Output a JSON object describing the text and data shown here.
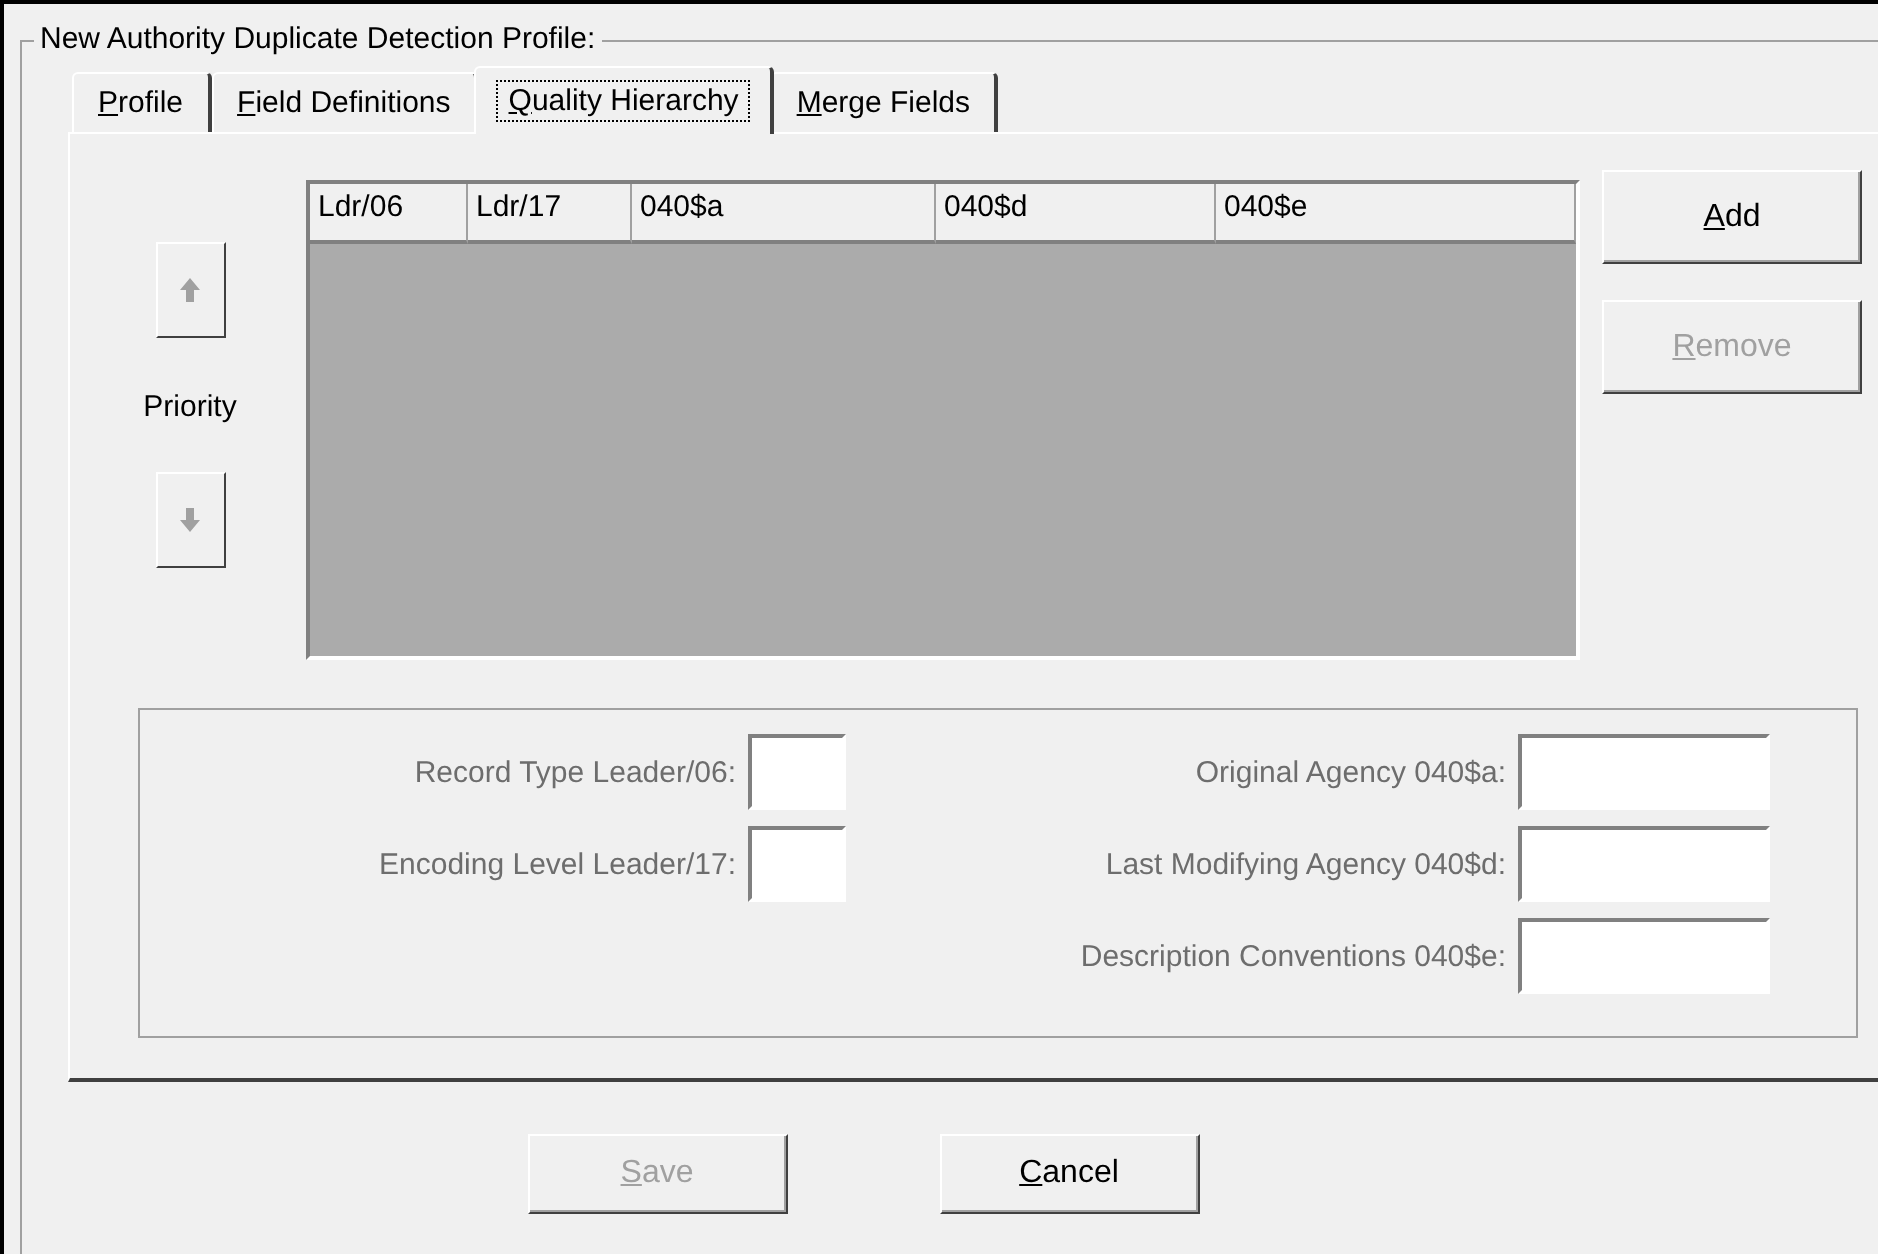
{
  "group_title": "New Authority Duplicate Detection Profile:",
  "tabs": [
    {
      "accel": "P",
      "rest": "rofile",
      "selected": false
    },
    {
      "accel": "F",
      "rest": "ield Definitions",
      "selected": false
    },
    {
      "accel": "Q",
      "rest": "uality Hierarchy",
      "selected": true
    },
    {
      "accel": "M",
      "rest": "erge Fields",
      "selected": false
    }
  ],
  "priority": {
    "label": "Priority",
    "up_disabled": true,
    "down_disabled": true
  },
  "table": {
    "columns": [
      "Ldr/06",
      "Ldr/17",
      "040$a",
      "040$d",
      "040$e"
    ]
  },
  "side_buttons": [
    {
      "accel": "A",
      "rest": "dd",
      "disabled": false
    },
    {
      "accel": "R",
      "rest": "emove",
      "disabled": true
    }
  ],
  "fields": {
    "disabled": true,
    "left": [
      {
        "label": "Record Type Leader/06:"
      },
      {
        "label": "Encoding Level Leader/17:"
      }
    ],
    "right": [
      {
        "label": "Original Agency 040$a:"
      },
      {
        "label": "Last Modifying Agency 040$d:"
      },
      {
        "label": "Description Conventions 040$e:"
      }
    ]
  },
  "buttons": [
    {
      "accel": "S",
      "rest": "ave",
      "disabled": true
    },
    {
      "accel": "C",
      "rest": "ancel",
      "disabled": false
    }
  ]
}
